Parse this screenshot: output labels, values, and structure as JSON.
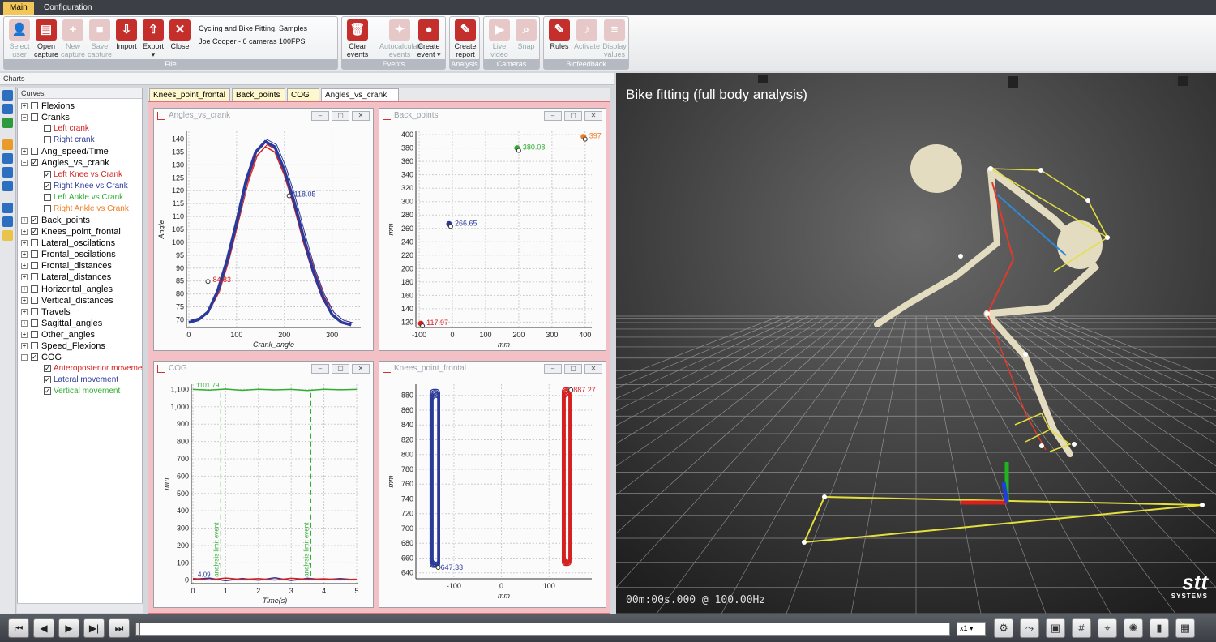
{
  "menu": {
    "tabs": [
      "Main",
      "Configuration"
    ]
  },
  "ribbon": {
    "file_buttons": [
      {
        "label1": "Select",
        "label2": "user",
        "icon": "user-icon",
        "glyph": "👤",
        "disabled": true
      },
      {
        "label1": "Open",
        "label2": "capture",
        "icon": "folder-open-icon",
        "glyph": "▤",
        "disabled": false
      },
      {
        "label1": "New",
        "label2": "capture",
        "icon": "new-capture-icon",
        "glyph": "+",
        "disabled": true
      },
      {
        "label1": "Save",
        "label2": "capture",
        "icon": "save-icon",
        "glyph": "■",
        "disabled": true
      },
      {
        "label1": "Import",
        "label2": "",
        "icon": "import-icon",
        "glyph": "⇩",
        "disabled": false
      },
      {
        "label1": "Export",
        "label2": "▾",
        "icon": "export-icon",
        "glyph": "⇧",
        "disabled": false
      },
      {
        "label1": "Close",
        "label2": "",
        "icon": "close-icon",
        "glyph": "✕",
        "disabled": false
      }
    ],
    "file_info": {
      "line1": "Cycling and Bike Fitting, Samples",
      "line2": "Joe Cooper - 6 cameras 100FPS"
    },
    "events_buttons": [
      {
        "label1": "Clear",
        "label2": "events",
        "icon": "trash-icon",
        "glyph": "🗑",
        "disabled": false
      },
      {
        "label1": "Autocalculate",
        "label2": "events",
        "icon": "magic-wand-icon",
        "glyph": "✦",
        "disabled": true
      },
      {
        "label1": "Create",
        "label2": "event ▾",
        "icon": "map-pin-icon",
        "glyph": "●",
        "disabled": false
      }
    ],
    "analysis_buttons": [
      {
        "label1": "Create",
        "label2": "report",
        "icon": "report-icon",
        "glyph": "✎",
        "disabled": false
      }
    ],
    "cameras_buttons": [
      {
        "label1": "Live",
        "label2": "video",
        "icon": "video-camera-icon",
        "glyph": "▶",
        "disabled": true
      },
      {
        "label1": "Snap",
        "label2": "",
        "icon": "magnifier-icon",
        "glyph": "⌕",
        "disabled": true
      }
    ],
    "biofeedback_buttons": [
      {
        "label1": "Rules",
        "label2": "",
        "icon": "rules-icon",
        "glyph": "✎",
        "disabled": false
      },
      {
        "label1": "Activate",
        "label2": "",
        "icon": "bell-icon",
        "glyph": "♪",
        "disabled": true
      },
      {
        "label1": "Display",
        "label2": "values",
        "icon": "list-icon",
        "glyph": "≡",
        "disabled": true
      }
    ],
    "groups": {
      "file": "File",
      "events": "Events",
      "analysis": "Analysis",
      "cameras": "Cameras",
      "biofeedback": "Biofeedback"
    }
  },
  "charts_header": "Charts",
  "curves": {
    "title": "Curves",
    "items": [
      {
        "label": "Flexions",
        "level": 0,
        "checked": false,
        "expanded": false,
        "color": "#000000"
      },
      {
        "label": "Cranks",
        "level": 0,
        "checked": false,
        "expanded": true,
        "color": "#000000"
      },
      {
        "label": "Left crank",
        "level": 1,
        "checked": false,
        "color": "#d62020"
      },
      {
        "label": "Right crank",
        "level": 1,
        "checked": false,
        "color": "#2b3a9a"
      },
      {
        "label": "Ang_speed/Time",
        "level": 0,
        "checked": false,
        "expanded": false,
        "color": "#000000"
      },
      {
        "label": "Angles_vs_crank",
        "level": 0,
        "checked": true,
        "expanded": true,
        "color": "#000000"
      },
      {
        "label": "Left Knee vs Crank",
        "level": 1,
        "checked": true,
        "color": "#d62020"
      },
      {
        "label": "Right Knee vs Crank",
        "level": 1,
        "checked": true,
        "color": "#2b3a9a"
      },
      {
        "label": "Left Ankle vs Crank",
        "level": 1,
        "checked": false,
        "color": "#2fae2f"
      },
      {
        "label": "Right Ankle vs Crank",
        "level": 1,
        "checked": false,
        "color": "#ef7d22"
      },
      {
        "label": "Back_points",
        "level": 0,
        "checked": true,
        "expanded": false,
        "color": "#000000"
      },
      {
        "label": "Knees_point_frontal",
        "level": 0,
        "checked": true,
        "expanded": false,
        "color": "#000000"
      },
      {
        "label": "Lateral_oscilations",
        "level": 0,
        "checked": false,
        "expanded": false,
        "color": "#000000"
      },
      {
        "label": "Frontal_oscilations",
        "level": 0,
        "checked": false,
        "expanded": false,
        "color": "#000000"
      },
      {
        "label": "Frontal_distances",
        "level": 0,
        "checked": false,
        "expanded": false,
        "color": "#000000"
      },
      {
        "label": "Lateral_distances",
        "level": 0,
        "checked": false,
        "expanded": false,
        "color": "#000000"
      },
      {
        "label": "Horizontal_angles",
        "level": 0,
        "checked": false,
        "expanded": false,
        "color": "#000000"
      },
      {
        "label": "Vertical_distances",
        "level": 0,
        "checked": false,
        "expanded": false,
        "color": "#000000"
      },
      {
        "label": "Travels",
        "level": 0,
        "checked": false,
        "expanded": false,
        "color": "#000000"
      },
      {
        "label": "Sagittal_angles",
        "level": 0,
        "checked": false,
        "expanded": false,
        "color": "#000000"
      },
      {
        "label": "Other_angles",
        "level": 0,
        "checked": false,
        "expanded": false,
        "color": "#000000"
      },
      {
        "label": "Speed_Flexions",
        "level": 0,
        "checked": false,
        "expanded": false,
        "color": "#000000"
      },
      {
        "label": "COG",
        "level": 0,
        "checked": true,
        "expanded": true,
        "color": "#000000"
      },
      {
        "label": "Anteroposterior movement",
        "level": 1,
        "checked": true,
        "color": "#d62020"
      },
      {
        "label": "Lateral movement",
        "level": 1,
        "checked": true,
        "color": "#2b3a9a"
      },
      {
        "label": "Vertical movement",
        "level": 1,
        "checked": true,
        "color": "#2fae2f"
      }
    ]
  },
  "chart_tabs": [
    {
      "label": "Knees_point_frontal",
      "active": false
    },
    {
      "label": "Back_points",
      "active": false
    },
    {
      "label": "COG",
      "active": false
    },
    {
      "label": "Angles_vs_crank",
      "active": true
    }
  ],
  "chart_data": [
    {
      "type": "line",
      "title": "Angles_vs_crank",
      "xlabel": "Crank_angle",
      "ylabel": "Angle",
      "xlim": [
        -5,
        360
      ],
      "ylim": [
        67,
        143
      ],
      "xticks": [
        0,
        100,
        200,
        300
      ],
      "yticks": [
        70,
        75,
        80,
        85,
        90,
        95,
        100,
        105,
        110,
        115,
        120,
        125,
        130,
        135,
        140
      ],
      "series": [
        {
          "color": "#d62020",
          "x": [
            0,
            20,
            40,
            60,
            80,
            100,
            120,
            140,
            160,
            180,
            200,
            220,
            240,
            260,
            280,
            300,
            320,
            340
          ],
          "y": [
            69,
            70,
            73,
            80,
            92,
            107,
            122,
            133,
            137,
            135,
            126,
            114,
            100,
            88,
            78,
            72,
            69,
            68
          ]
        },
        {
          "color": "#2b3a9a",
          "x": [
            0,
            20,
            40,
            60,
            80,
            100,
            120,
            140,
            160,
            180,
            200,
            220,
            240,
            260,
            280,
            300,
            320,
            340
          ],
          "y": [
            69,
            70,
            73,
            81,
            93,
            108,
            124,
            135,
            139,
            137,
            128,
            116,
            102,
            89,
            79,
            72,
            69,
            68
          ]
        }
      ],
      "annotations": [
        {
          "x": 210,
          "y": 118.05,
          "text": "118.05",
          "color": "#2b3a9a"
        },
        {
          "x": 40,
          "y": 84.83,
          "text": "84.83",
          "color": "#d62020"
        }
      ]
    },
    {
      "type": "scatter",
      "title": "Back_points",
      "xlabel": "mm",
      "ylabel": "mm",
      "xlim": [
        -110,
        420
      ],
      "ylim": [
        112,
        405
      ],
      "xticks": [
        -100,
        0,
        100,
        200,
        300,
        400
      ],
      "yticks": [
        120,
        140,
        160,
        180,
        200,
        220,
        240,
        260,
        280,
        300,
        320,
        340,
        360,
        380,
        400
      ],
      "points": [
        {
          "x": -95,
          "y": 117.97,
          "text": "117.97",
          "color": "#d62020"
        },
        {
          "x": -10,
          "y": 266.65,
          "text": "266.65",
          "color": "#2b3a9a"
        },
        {
          "x": 195,
          "y": 380.08,
          "text": "380.08",
          "color": "#2fae2f"
        },
        {
          "x": 395,
          "y": 397,
          "text": "397",
          "color": "#ef7d22"
        }
      ]
    },
    {
      "type": "line",
      "title": "COG",
      "xlabel": "Time(s)",
      "ylabel": "mm",
      "xlim": [
        -0.05,
        5.05
      ],
      "ylim": [
        -20,
        1130
      ],
      "xticks": [
        0,
        1,
        2,
        3,
        4,
        5
      ],
      "yticks": [
        0,
        100,
        200,
        300,
        400,
        500,
        600,
        700,
        800,
        900,
        1000,
        1100
      ],
      "series": [
        {
          "name": "Vertical movement",
          "color": "#2fae2f",
          "x": [
            0,
            0.5,
            1,
            1.5,
            2,
            2.5,
            3,
            3.5,
            4,
            4.5,
            5
          ],
          "y": [
            1100,
            1096,
            1102,
            1095,
            1101,
            1097,
            1100,
            1094,
            1101,
            1098,
            1100
          ]
        },
        {
          "name": "Lateral movement",
          "color": "#2b3a9a",
          "x": [
            0,
            0.5,
            1,
            1.5,
            2,
            2.5,
            3,
            3.5,
            4,
            4.5,
            5
          ],
          "y": [
            5,
            12,
            -3,
            10,
            0,
            14,
            -2,
            11,
            3,
            9,
            2
          ]
        },
        {
          "name": "Anteroposterior movement",
          "color": "#d62020",
          "x": [
            0,
            0.5,
            1,
            1.5,
            2,
            2.5,
            3,
            3.5,
            4,
            4.5,
            5
          ],
          "y": [
            10,
            2,
            12,
            4,
            9,
            1,
            11,
            5,
            8,
            3,
            6
          ]
        }
      ],
      "events": [
        {
          "x": 0.85,
          "label": "analysis limit event"
        },
        {
          "x": 3.6,
          "label": "analysis limit event"
        }
      ],
      "annotations": [
        {
          "x": 0.05,
          "y": 1101.79,
          "text": "1101.79",
          "color": "#2fae2f"
        },
        {
          "x": 0.1,
          "y": 10,
          "text": "4.09",
          "color": "#2b3a9a"
        }
      ]
    },
    {
      "type": "line",
      "title": "Knees_point_frontal",
      "xlabel": "mm",
      "ylabel": "mm",
      "xlim": [
        -180,
        190
      ],
      "ylim": [
        632,
        895
      ],
      "xticks": [
        -100,
        0,
        100
      ],
      "yticks": [
        640,
        660,
        680,
        700,
        720,
        740,
        760,
        780,
        800,
        820,
        840,
        860,
        880
      ],
      "series": [
        {
          "color": "#2b3a9a",
          "xmin": -150,
          "xmax": -130,
          "ymin": 647.33,
          "ymax": 888
        },
        {
          "color": "#d62020",
          "xmin": 128,
          "xmax": 146,
          "ymin": 650,
          "ymax": 890
        }
      ],
      "annotations": [
        {
          "x": -133,
          "y": 647.33,
          "text": "647.33",
          "color": "#2b3a9a"
        },
        {
          "x": 146,
          "y": 887.27,
          "text": "887.27",
          "color": "#d62020"
        }
      ]
    }
  ],
  "viewport": {
    "title": "Bike fitting (full body analysis)",
    "time": "00m:00s.000 @ 100.00Hz",
    "brand": "stt",
    "brand_sub": "SYSTEMS"
  },
  "playback": {
    "speed": "x1",
    "buttons": [
      {
        "glyph": "⏮",
        "icon": "skip-start-icon"
      },
      {
        "glyph": "◀",
        "icon": "step-back-icon"
      },
      {
        "glyph": "▶",
        "icon": "play-icon"
      },
      {
        "glyph": "▶|",
        "icon": "step-forward-icon"
      },
      {
        "glyph": "⏭",
        "icon": "skip-end-icon"
      }
    ]
  },
  "toolbar_icons": [
    "skeleton-view-icon",
    "bone-icon",
    "cube-icon",
    "grid-icon",
    "target-icon",
    "aperture-icon",
    "bar-chart-icon",
    "film-icon"
  ]
}
